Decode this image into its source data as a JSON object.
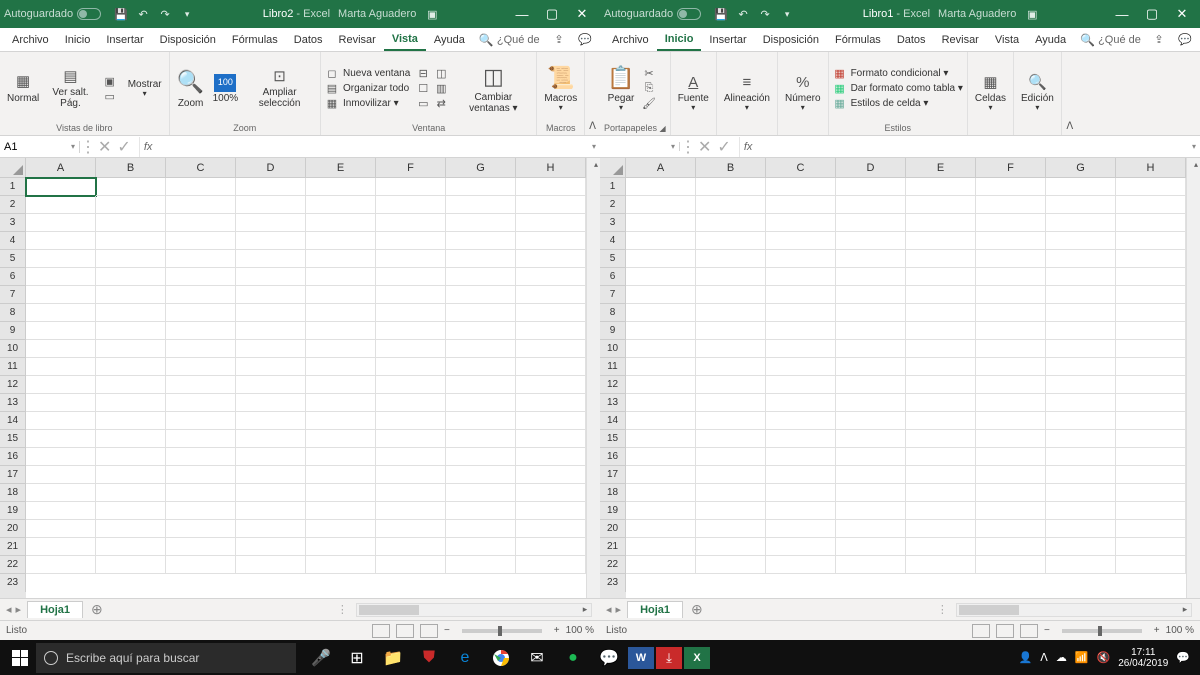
{
  "taskbar": {
    "search_placeholder": "Escribe aquí para buscar",
    "time": "17:11",
    "date": "26/04/2019"
  },
  "windows": [
    {
      "id": "left",
      "autosave_label": "Autoguardado",
      "doc_title": "Libro2",
      "app_suffix": " - Excel",
      "user": "Marta Aguadero",
      "active_tab": "Vista",
      "name_box": "A1",
      "tabs": [
        "Archivo",
        "Inicio",
        "Insertar",
        "Disposición",
        "Fórmulas",
        "Datos",
        "Revisar",
        "Vista",
        "Ayuda"
      ],
      "tell_me": "¿Qué de",
      "ribbon_groups": [
        {
          "label": "Vistas de libro",
          "buttons": [
            "Normal",
            "Ver salt. Pág."
          ],
          "extra": [
            "Mostrar"
          ]
        },
        {
          "label": "Zoom",
          "buttons": [
            "Zoom",
            "100%",
            "Ampliar selección"
          ]
        },
        {
          "label": "Ventana",
          "stack": [
            "Nueva ventana",
            "Organizar todo",
            "Inmovilizar ▾"
          ],
          "buttons": [
            "Cambiar ventanas ▾"
          ]
        },
        {
          "label": "Macros",
          "buttons": [
            "Macros"
          ]
        }
      ],
      "sheet_tab": "Hoja1",
      "status": "Listo",
      "zoom": "100 %",
      "columns": [
        "A",
        "B",
        "C",
        "D",
        "E",
        "F",
        "G",
        "H"
      ],
      "rows": 22
    },
    {
      "id": "right",
      "autosave_label": "Autoguardado",
      "doc_title": "Libro1",
      "app_suffix": " - Excel",
      "user": "Marta Aguadero",
      "active_tab": "Inicio",
      "name_box": "",
      "tabs": [
        "Archivo",
        "Inicio",
        "Insertar",
        "Disposición",
        "Fórmulas",
        "Datos",
        "Revisar",
        "Vista",
        "Ayuda"
      ],
      "tell_me": "¿Qué de",
      "ribbon_groups": [
        {
          "label": "Portapapeles",
          "buttons": [
            "Pegar"
          ]
        },
        {
          "label": "",
          "buttons": [
            "Fuente"
          ]
        },
        {
          "label": "",
          "buttons": [
            "Alineación"
          ]
        },
        {
          "label": "",
          "buttons": [
            "Número"
          ]
        },
        {
          "label": "Estilos",
          "stack": [
            "Formato condicional ▾",
            "Dar formato como tabla ▾",
            "Estilos de celda ▾"
          ]
        },
        {
          "label": "",
          "buttons": [
            "Celdas"
          ]
        },
        {
          "label": "",
          "buttons": [
            "Edición"
          ]
        }
      ],
      "sheet_tab": "Hoja1",
      "status": "Listo",
      "zoom": "100 %",
      "columns": [
        "A",
        "B",
        "C",
        "D",
        "E",
        "F",
        "G",
        "H"
      ],
      "rows": 22
    }
  ]
}
